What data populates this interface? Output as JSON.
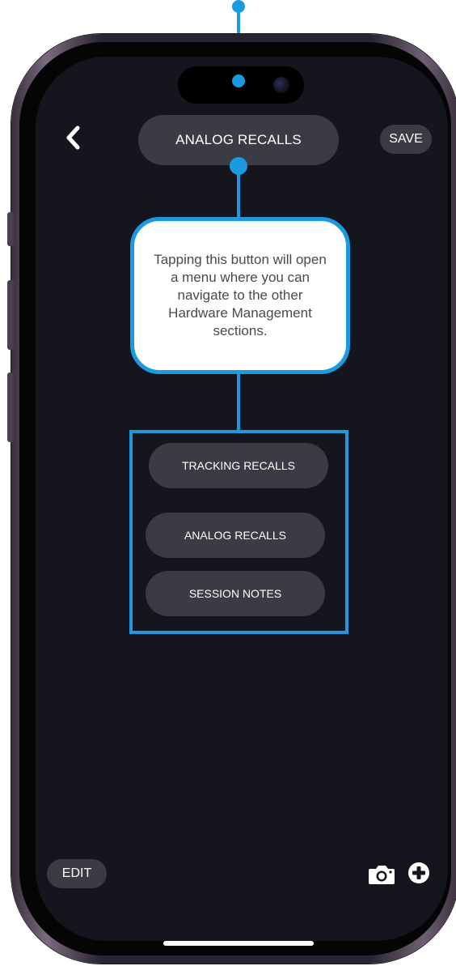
{
  "header": {
    "section_title": "ANALOG RECALLS",
    "save_label": "SAVE",
    "back_icon": "chevron-left-icon"
  },
  "callout": {
    "text": "Tapping this button will open a menu where you can navigate to the other Hardware Management sections."
  },
  "menu": {
    "items": [
      {
        "label": "TRACKING RECALLS"
      },
      {
        "label": "ANALOG RECALLS"
      },
      {
        "label": "SESSION NOTES"
      }
    ]
  },
  "footer": {
    "edit_label": "EDIT",
    "camera_icon": "camera-icon",
    "add_icon": "plus-circle-icon"
  },
  "colors": {
    "accent": "#1a9be0",
    "screen_bg": "#15161d",
    "pill_bg": "#3a3b43",
    "text": "#ffffff"
  }
}
